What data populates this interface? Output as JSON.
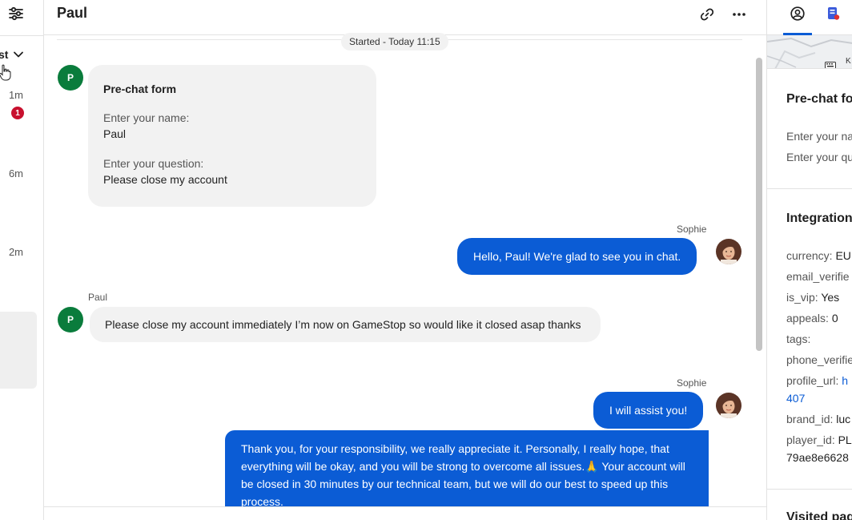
{
  "left_panel": {
    "list_label": "st",
    "times": [
      "1m",
      "6m",
      "2m"
    ],
    "unread_count": "1"
  },
  "header": {
    "title": "Paul"
  },
  "conversation": {
    "started_label": "Started - Today 11:15",
    "prechat_form": {
      "avatar_initial": "P",
      "title": "Pre-chat form",
      "name_label": "Enter your name:",
      "name_value": "Paul",
      "question_label": "Enter your question:",
      "question_value": "Please close my account"
    },
    "messages": [
      {
        "sender": "Sophie",
        "text": "Hello, Paul! We're glad to see you in chat."
      },
      {
        "sender": "Paul",
        "avatar_initial": "P",
        "text": "Please close my account immediately I’m now on GameStop so would like it closed asap thanks"
      },
      {
        "sender": "Sophie",
        "text": "I will assist you!"
      },
      {
        "sender": "Sophie",
        "text": "Thank you, for your responsibility, we really appreciate it. Personally, I really hope, that everything will be okay, and you will be strong to overcome all issues.🙏 Your account will be closed in 30 minutes by our technical team, but we will do our best to speed up this process."
      }
    ]
  },
  "details": {
    "map_label": "K",
    "prechat_section": {
      "title": "Pre-chat fo",
      "rows": [
        "Enter your na",
        "Enter your qu"
      ]
    },
    "integration_section": {
      "title": "Integration",
      "rows": [
        {
          "key": "currency:",
          "value": "EU"
        },
        {
          "key": "email_verifie",
          "value": ""
        },
        {
          "key": "is_vip:",
          "value": "Yes"
        },
        {
          "key": "appeals:",
          "value": "0"
        },
        {
          "key": "tags:",
          "value": ""
        },
        {
          "key": "phone_verifie",
          "value": ""
        },
        {
          "key": "profile_url:",
          "value": "h",
          "value_line2": "407"
        },
        {
          "key": "brand_id:",
          "value": "luc"
        },
        {
          "key": "player_id:",
          "value": "PL",
          "value_line2": "79ae8e6628"
        }
      ]
    },
    "visited_section": {
      "title": "Visited pag"
    }
  }
}
